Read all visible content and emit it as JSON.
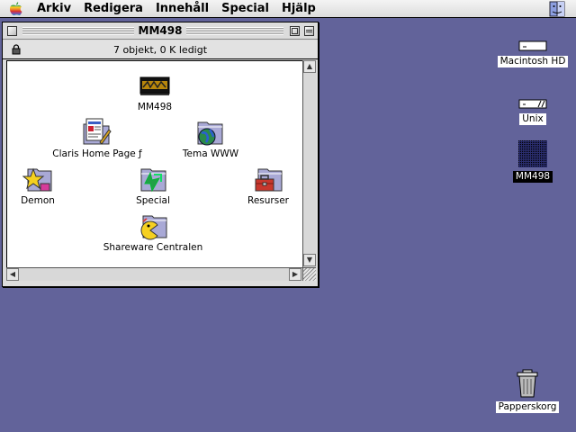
{
  "menubar": {
    "apple_icon": "apple-icon",
    "items": [
      "Arkiv",
      "Redigera",
      "Innehåll",
      "Special",
      "Hjälp"
    ],
    "app_switcher_icon": "finder-icon"
  },
  "window": {
    "title": "MM498",
    "info": "7 objekt, 0 K ledigt",
    "icons": [
      {
        "label": "MM498",
        "icon": "application-icon"
      },
      {
        "label": "Claris Home Page ƒ",
        "icon": "claris-folder-icon"
      },
      {
        "label": "Tema WWW",
        "icon": "globe-folder-icon"
      },
      {
        "label": "Demon",
        "icon": "star-folder-icon"
      },
      {
        "label": "Special",
        "icon": "arrow-folder-icon"
      },
      {
        "label": "Resurser",
        "icon": "toolbox-folder-icon"
      },
      {
        "label": "Shareware Centralen",
        "icon": "pacman-folder-icon"
      }
    ]
  },
  "desktop": {
    "icons": [
      {
        "label": "Macintosh HD",
        "icon": "hard-disk-icon"
      },
      {
        "label": "Unix",
        "icon": "disk-icon"
      },
      {
        "label": "MM498",
        "icon": "cd-volume-icon"
      },
      {
        "label": "Papperskorg",
        "icon": "trash-icon"
      }
    ]
  },
  "colors": {
    "desktop": "#62639a",
    "window": "#dddddd",
    "selection": "#000000"
  }
}
